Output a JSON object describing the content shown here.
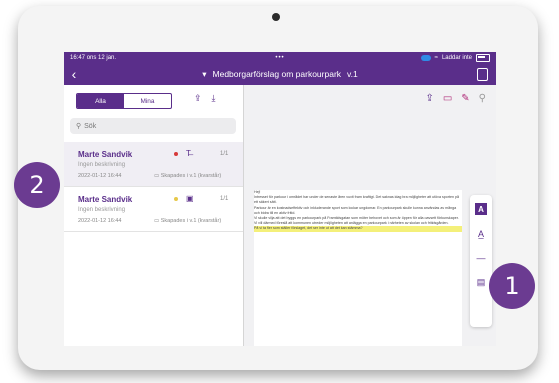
{
  "status": {
    "time": "16:47",
    "date": "ons 12 jan.",
    "center": "•••",
    "charging": "Laddar inte"
  },
  "nav": {
    "back_label": "‹",
    "title": "Medborgarförslag om parkourpark",
    "version": "v.1"
  },
  "tabs": [
    {
      "label": "Alla"
    },
    {
      "label": "Mina"
    }
  ],
  "search": {
    "placeholder": "Sök"
  },
  "items": [
    {
      "name": "Marte Sandvik",
      "desc": "Ingen beskrivning",
      "date": "2022-01-12 16:44",
      "meta": "Skapades i v.1 (kvarstår)",
      "page": "1/1",
      "dot_color": "#d63a3a"
    },
    {
      "name": "Marte Sandvik",
      "desc": "Ingen beskrivning",
      "date": "2022-01-12 16:44",
      "meta": "Skapades i v.1 (kvarstår)",
      "page": "1/1",
      "dot_color": "#e6c84a"
    }
  ],
  "doc": {
    "greeting": "Hej!",
    "para1": "Intresset för parkour i området har under de senaste åren vuxit fram kraftigt. Det saknas idag bra möjligheter att utöva sporten på ett säkert sätt.",
    "para2": "Parkour är en kostnadseffektiv och inkluderande sport som lockar ungdomar. En parkourpark skulle kunna användas av många och bidra till en aktiv fritid.",
    "para3": "Vi skulle vilja att det byggs en parkourpark på Framtidsgatan som möter behovet och som är öppen för alla oavsett förkunskaper.",
    "para4": "Vi vill därmed föreslå att kommunen utreder möjligheten att anlägga en parkourpark i närheten av skolan och fritidsgården.",
    "highlight": "På vi ta fler som ställer förslaget, det ser inte ut att det kan stämma?"
  },
  "badges": {
    "left": "2",
    "right": "1"
  },
  "colors": {
    "accent": "#5a2e8a",
    "badge": "#6b3b91",
    "highlight": "#f4f07a"
  },
  "icons": [
    "share-icon",
    "download-icon",
    "search-icon",
    "comment-icon",
    "edit-icon",
    "text-highlight-icon",
    "text-underline-icon",
    "strike-icon",
    "note-icon"
  ]
}
